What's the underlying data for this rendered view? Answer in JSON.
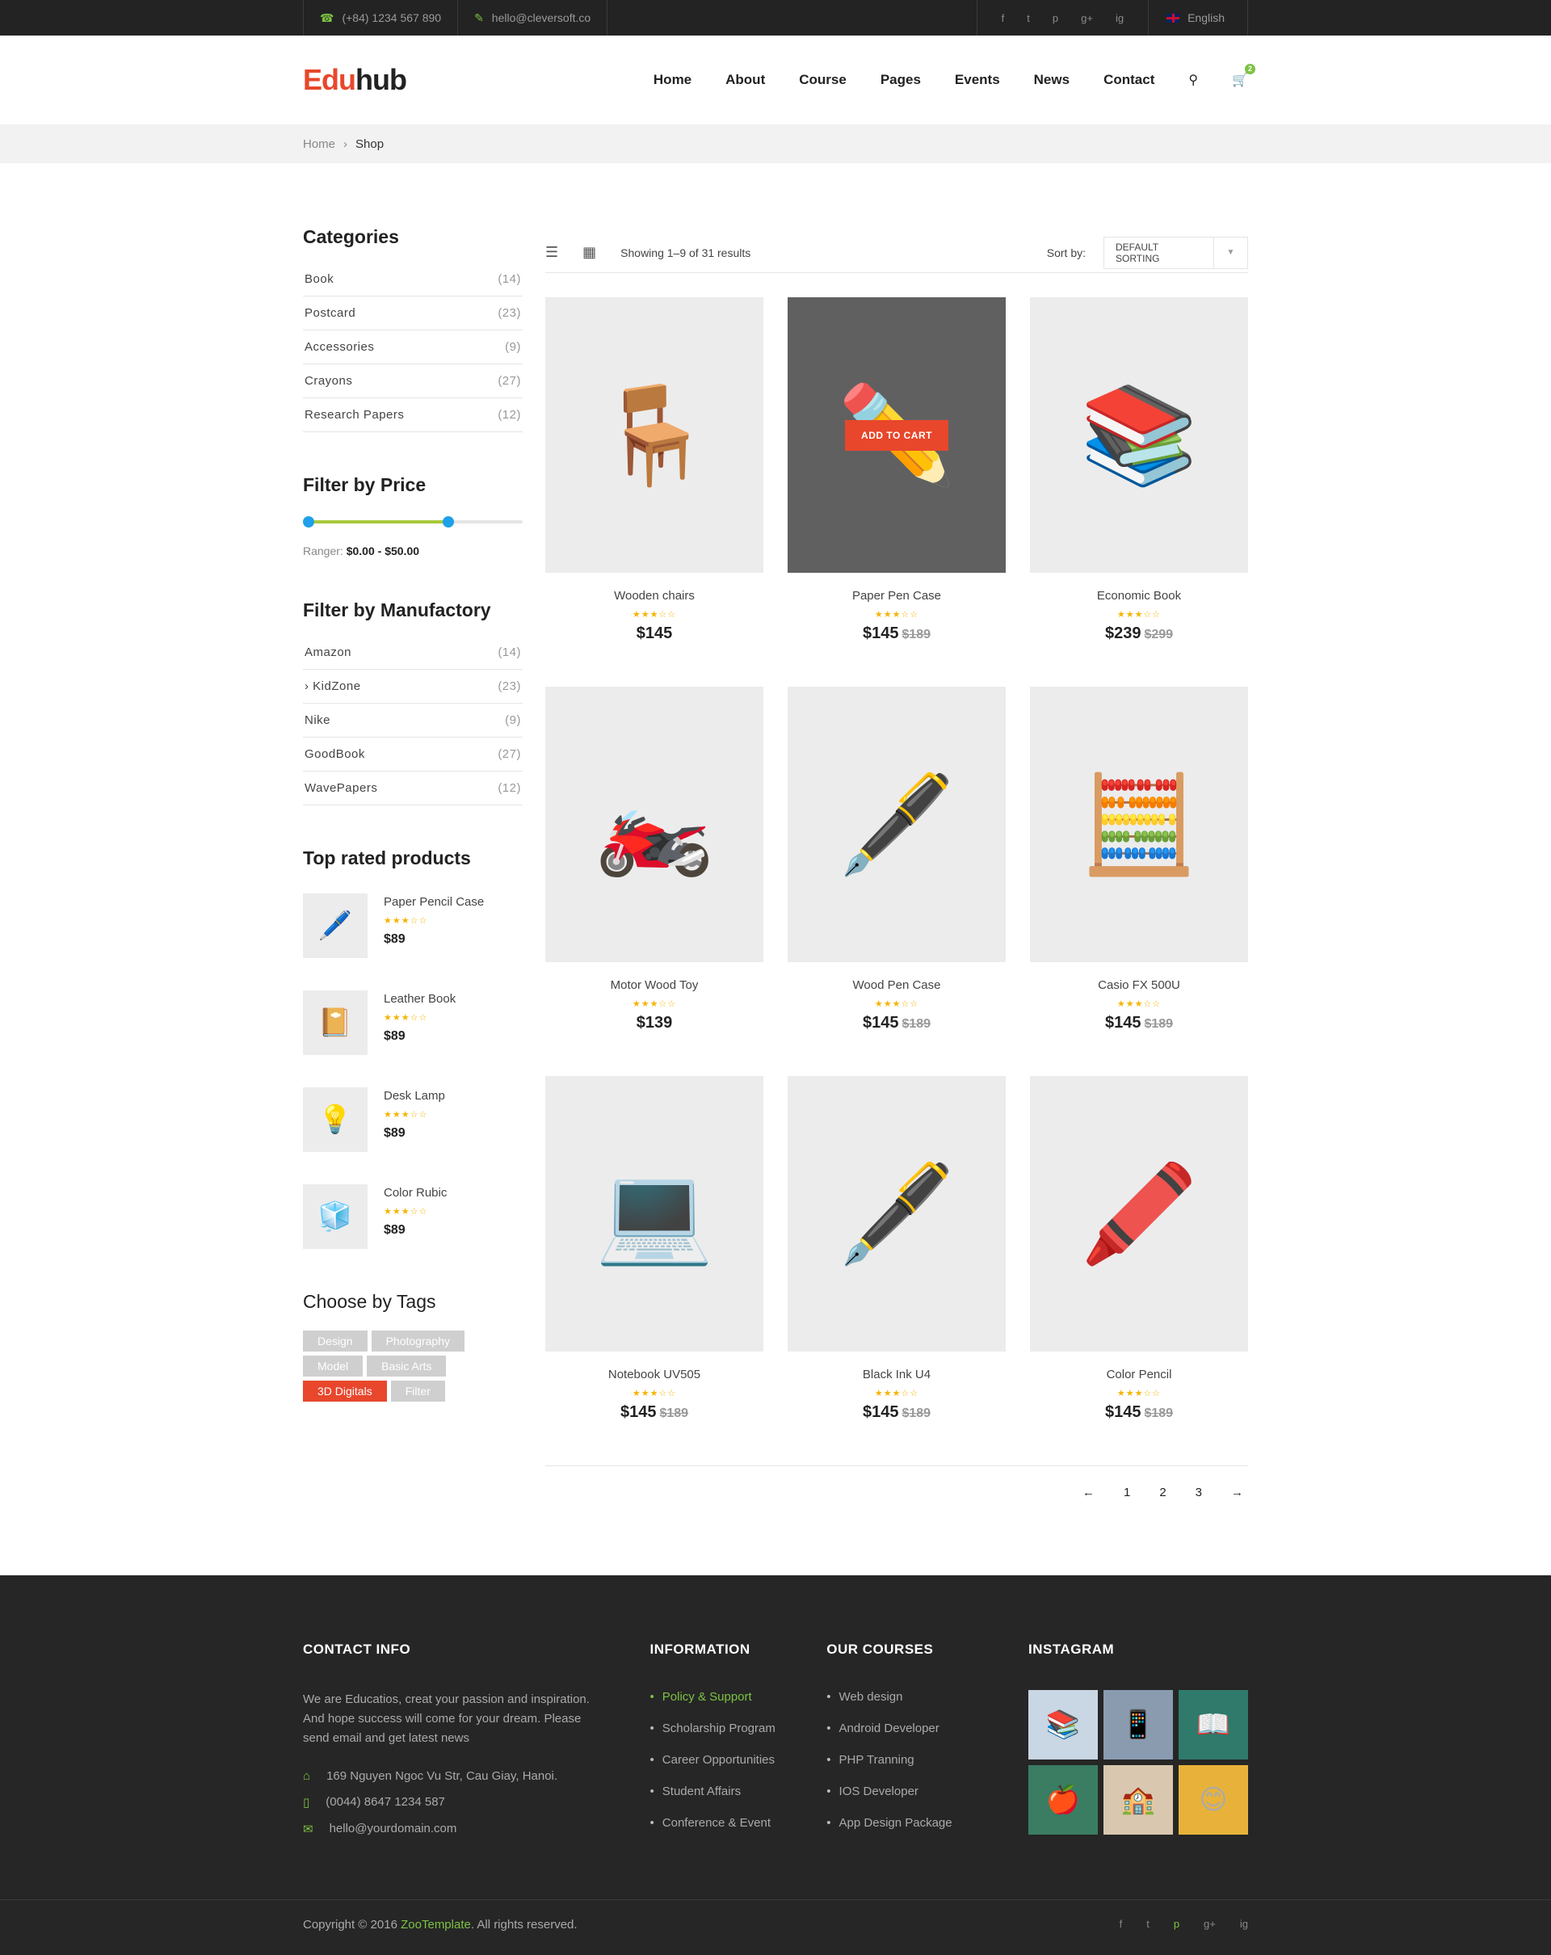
{
  "topbar": {
    "phone": "(+84) 1234 567 890",
    "email": "hello@cleversoft.co",
    "socials": [
      "f",
      "t",
      "p",
      "g+",
      "ig"
    ],
    "language": "English"
  },
  "header": {
    "logo_part1": "Edu",
    "logo_part2": "hub",
    "nav": [
      "Home",
      "About",
      "Course",
      "Pages",
      "Events",
      "News",
      "Contact"
    ],
    "cart_count": "2"
  },
  "breadcrumb": {
    "home": "Home",
    "sep": "›",
    "current": "Shop"
  },
  "sidebar": {
    "categories_title": "Categories",
    "categories": [
      {
        "label": "Book",
        "count": "(14)"
      },
      {
        "label": "Postcard",
        "count": "(23)"
      },
      {
        "label": "Accessories",
        "count": "(9)"
      },
      {
        "label": "Crayons",
        "count": "(27)"
      },
      {
        "label": "Research Papers",
        "count": "(12)"
      }
    ],
    "price_title": "Filter by Price",
    "price_min_fraction": 0.0,
    "price_max_fraction": 0.67,
    "ranger_label": "Ranger:",
    "ranger_min": "$0.00",
    "ranger_sep": "-",
    "ranger_max": "$50.00",
    "manufactory_title": "Filter by Manufactory",
    "manufactory": [
      {
        "label": "Amazon",
        "count": "(14)"
      },
      {
        "label": "› KidZone",
        "count": "(23)"
      },
      {
        "label": "Nike",
        "count": "(9)"
      },
      {
        "label": "GoodBook",
        "count": "(27)"
      },
      {
        "label": "WavePapers",
        "count": "(12)"
      }
    ],
    "top_title": "Top rated products",
    "top_products": [
      {
        "name": "Paper Pencil Case",
        "price": "$89",
        "icon": "🖊️",
        "rating": 3
      },
      {
        "name": "Leather Book",
        "price": "$89",
        "icon": "📔",
        "rating": 3
      },
      {
        "name": "Desk Lamp",
        "price": "$89",
        "icon": "💡",
        "rating": 3
      },
      {
        "name": "Color Rubic",
        "price": "$89",
        "icon": "🧊",
        "rating": 3
      }
    ],
    "tags_title": "Choose by Tags",
    "tags": [
      "Design",
      "Photography",
      "Model",
      "Basic Arts",
      "3D Digitals",
      "Filter"
    ],
    "active_tag": "3D Digitals"
  },
  "toolbar": {
    "showing": "Showing 1–9 of 31 results",
    "sort_label": "Sort by:",
    "sort_value": "DEFAULT SORTING"
  },
  "products": [
    {
      "name": "Wooden chairs",
      "price": "$145",
      "old": "",
      "icon": "🪑",
      "rating": 3
    },
    {
      "name": "Paper Pen Case",
      "price": "$145",
      "old": "$189",
      "icon": "✏️",
      "rating": 3,
      "hover": true
    },
    {
      "name": "Economic Book",
      "price": "$239",
      "old": "$299",
      "icon": "📚",
      "rating": 3
    },
    {
      "name": "Motor Wood Toy",
      "price": "$139",
      "old": "",
      "icon": "🏍️",
      "rating": 3
    },
    {
      "name": "Wood Pen Case",
      "price": "$145",
      "old": "$189",
      "icon": "🖋️",
      "rating": 3
    },
    {
      "name": "Casio FX 500U",
      "price": "$145",
      "old": "$189",
      "icon": "🧮",
      "rating": 3
    },
    {
      "name": "Notebook UV505",
      "price": "$145",
      "old": "$189",
      "icon": "💻",
      "rating": 3
    },
    {
      "name": "Black Ink U4",
      "price": "$145",
      "old": "$189",
      "icon": "🖋️",
      "rating": 3
    },
    {
      "name": "Color Pencil",
      "price": "$145",
      "old": "$189",
      "icon": "🖍️",
      "rating": 3
    }
  ],
  "add_to_cart": "ADD TO CART",
  "pagination": [
    "←",
    "1",
    "2",
    "3",
    "→"
  ],
  "footer": {
    "contact_title": "CONTACT INFO",
    "about": "We are Educatios, creat your passion and inspiration. And hope success will come for your dream. Please send email and get latest news",
    "address": "169 Nguyen Ngoc Vu Str, Cau Giay, Hanoi.",
    "phone": "(0044) 8647 1234 587",
    "email": "hello@yourdomain.com",
    "info_title": "INFORMATION",
    "info_links": [
      "Policy & Support",
      "Scholarship Program",
      "Career Opportunities",
      "Student Affairs",
      "Conference & Event"
    ],
    "courses_title": "OUR COURSES",
    "courses_links": [
      "Web design",
      "Android Developer",
      "PHP Tranning",
      "IOS Developer",
      "App Design Package"
    ],
    "instagram_title": "INSTAGRAM",
    "instagram": [
      "📚",
      "📱",
      "📖",
      "🍎",
      "🏫",
      "😊"
    ],
    "copyright_pre": "Copyright © 2016",
    "copyright_brand": "ZooTemplate",
    "copyright_post": ". All rights reserved.",
    "socials": [
      "f",
      "t",
      "p",
      "g+",
      "ig"
    ]
  },
  "colors": {
    "accent": "#e8472c",
    "green": "#7cc242",
    "slider": "#1ea1e9"
  }
}
